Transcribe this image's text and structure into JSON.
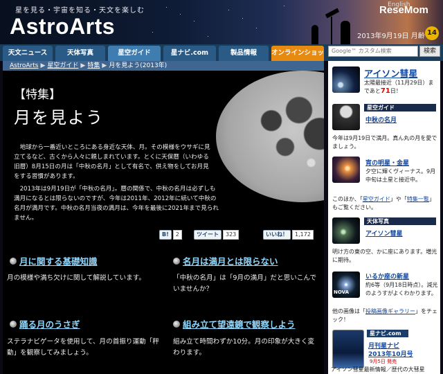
{
  "header": {
    "tagline": "星を見る・宇宙を知る・天文を楽しむ",
    "logo": "AstroArts",
    "lang": "English",
    "brand": "ReseMom",
    "date": "2013年9月19日 月齢",
    "moon_age": "14"
  },
  "nav": {
    "tabs": [
      "天文ニュース",
      "天体写真",
      "星空ガイド",
      "星ナビ.com",
      "製品情報",
      "オンラインショップ"
    ],
    "search_placeholder": "Google™ カスタム検索",
    "search_button": "検索"
  },
  "breadcrumb": [
    "AstroArts",
    "星空ガイド",
    "特集",
    "月を見よう(2013年)"
  ],
  "feature": {
    "label": "【特集】",
    "title": "月を見よう",
    "intro1": "地球から一番近いところにある身近な天体、月。その模様をウサギに見立てるなど、古くから人々に親しまれています。とくに天保暦（いわゆる旧暦）8月15日の月は「中秋の名月」として有名で、供え物をしてお月見をする習慣があります。",
    "intro2": "2013年は9月19日が「中秋の名月」。暦の関係で、中秋の名月は必ずしも満月になるとは限らないのですが、今年は2011年、2012年に続いて中秋の名月が満月です。中秋の名月当夜の満月は、今年を最後に2021年まで見られません。"
  },
  "social": {
    "hatena_label": "B!",
    "hatena_count": "2",
    "tweet_label": "ツイート",
    "tweet_count": "323",
    "like_label": "いいね！",
    "like_count": "1,172"
  },
  "sections": [
    {
      "title": "月に関する基礎知識",
      "desc": "月の模様や満ち欠けに関して解説しています。"
    },
    {
      "title": "名月は満月とは限らない",
      "desc": "「中秋の名月」は「9月の満月」だと思いこんでいませんか？"
    },
    {
      "title": "踊る月のうさぎ",
      "desc": "ステラナビゲータを使用して、月の首振り運動「秤動」を観察してみましょう。"
    },
    {
      "title": "組み立て望遠鏡で観察しよう",
      "desc": "組み立て時間わずか10分。月の印象が大きく変わります。"
    }
  ],
  "sidebar": {
    "ison_title": "アイソン彗星",
    "ison_text_pre": "太陽最接近（11月29日）まであと",
    "ison_days": "71",
    "ison_text_post": "日！",
    "guide_tag": "星空ガイド",
    "guide_link": "中秋の名月",
    "guide_text": "今年は9月19日で満月。真ん丸の月を愛でましょう。",
    "venus_link": "宵の明星・金星",
    "venus_text": "夕空に輝くヴィーナス。9月中旬は土星と接近中。",
    "more_pre": "このほか、「",
    "more_link1": "星空ガイド",
    "more_mid": "」や「",
    "more_link2": "特集一覧",
    "more_post": "」もご覧ください。",
    "photo_tag": "天体写真",
    "photo_link": "アイソン彗星",
    "photo_text": "明け方の東の空、かに座にあります。増光に期待。",
    "nova_link": "いるか座の新星",
    "nova_text": "約6等（9月18日時点）。減光のようすがよくわかります。",
    "gallery_pre": "他の画像は「",
    "gallery_link": "投稿画像ギャラリー",
    "gallery_post": "」をチェック！",
    "hoshinavi_logo": "星ナビ.com",
    "mag_title": "月刊星ナビ",
    "mag_issue": "2013年10月号",
    "mag_release": "9月5日 発売",
    "mag_text": "アイソン彗星最新情報／歴代の大彗星",
    "img_label": "NOVA"
  }
}
